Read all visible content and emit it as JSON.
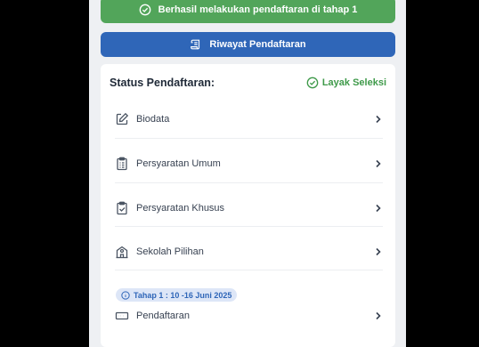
{
  "banner": {
    "text": "Berhasil melakukan pendaftaran di tahap 1",
    "icon": "check-circle-icon"
  },
  "history_button": {
    "label": "Riwayat Pendaftaran",
    "icon": "scroll-icon"
  },
  "status_card": {
    "title": "Status Pendaftaran:",
    "status_label": "Layak Seleksi",
    "status_icon": "check-circle-icon",
    "status_color": "#3f9a4a"
  },
  "menu": [
    {
      "label": "Biodata",
      "icon": "edit-icon"
    },
    {
      "label": "Persyaratan Umum",
      "icon": "clipboard-list-icon"
    },
    {
      "label": "Persyaratan Khusus",
      "icon": "clipboard-check-icon"
    },
    {
      "label": "Sekolah Pilihan",
      "icon": "school-icon"
    }
  ],
  "phase": {
    "label": "Tahap 1 : 10 -16 Juni 2025",
    "icon": "info-icon"
  },
  "registration": {
    "label": "Pendaftaran",
    "icon": "form-icon"
  },
  "colors": {
    "success": "#52a55a",
    "primary": "#2f66b8",
    "phase_bg": "#dde6f7"
  }
}
